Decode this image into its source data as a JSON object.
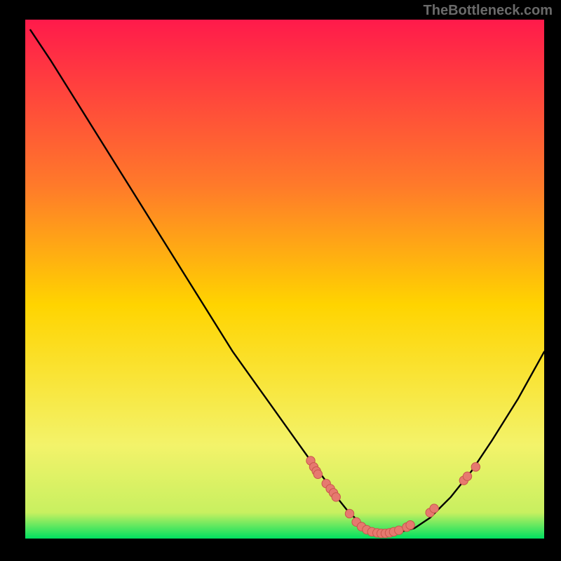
{
  "watermark": "TheBottleneck.com",
  "colors": {
    "gradient_top": "#ff1a4b",
    "gradient_mid": "#ffd400",
    "gradient_bottom": "#00e060",
    "curve": "#000000",
    "marker_fill": "#e6796f",
    "marker_stroke": "#c9564c",
    "background": "#000000"
  },
  "chart_data": {
    "type": "line",
    "title": "",
    "xlabel": "",
    "ylabel": "",
    "xlim": [
      0,
      100
    ],
    "ylim": [
      0,
      100
    ],
    "curve": {
      "x": [
        1,
        5,
        10,
        15,
        20,
        25,
        30,
        35,
        40,
        45,
        50,
        55,
        58,
        60,
        62,
        64,
        66,
        68,
        70,
        72,
        75,
        78,
        82,
        86,
        90,
        95,
        100
      ],
      "y": [
        98,
        92,
        84,
        76,
        68,
        60,
        52,
        44,
        36,
        29,
        22,
        15,
        11,
        8,
        5.5,
        3.5,
        2.2,
        1.4,
        1.1,
        1.2,
        2.0,
        4.0,
        8.0,
        13,
        19,
        27,
        36
      ]
    },
    "markers": [
      {
        "x": 55.0,
        "y": 15.0
      },
      {
        "x": 55.6,
        "y": 13.8
      },
      {
        "x": 56.1,
        "y": 13.0
      },
      {
        "x": 56.4,
        "y": 12.4
      },
      {
        "x": 58.0,
        "y": 10.6
      },
      {
        "x": 58.8,
        "y": 9.6
      },
      {
        "x": 59.4,
        "y": 8.8
      },
      {
        "x": 59.9,
        "y": 8.0
      },
      {
        "x": 62.5,
        "y": 4.8
      },
      {
        "x": 63.8,
        "y": 3.2
      },
      {
        "x": 64.8,
        "y": 2.3
      },
      {
        "x": 65.8,
        "y": 1.7
      },
      {
        "x": 66.8,
        "y": 1.3
      },
      {
        "x": 67.8,
        "y": 1.1
      },
      {
        "x": 68.6,
        "y": 1.0
      },
      {
        "x": 69.4,
        "y": 1.0
      },
      {
        "x": 70.2,
        "y": 1.1
      },
      {
        "x": 71.0,
        "y": 1.3
      },
      {
        "x": 72.0,
        "y": 1.6
      },
      {
        "x": 73.5,
        "y": 2.2
      },
      {
        "x": 74.2,
        "y": 2.6
      },
      {
        "x": 78.0,
        "y": 5.0
      },
      {
        "x": 78.8,
        "y": 5.8
      },
      {
        "x": 84.5,
        "y": 11.2
      },
      {
        "x": 85.2,
        "y": 12.0
      },
      {
        "x": 86.8,
        "y": 13.8
      }
    ]
  }
}
